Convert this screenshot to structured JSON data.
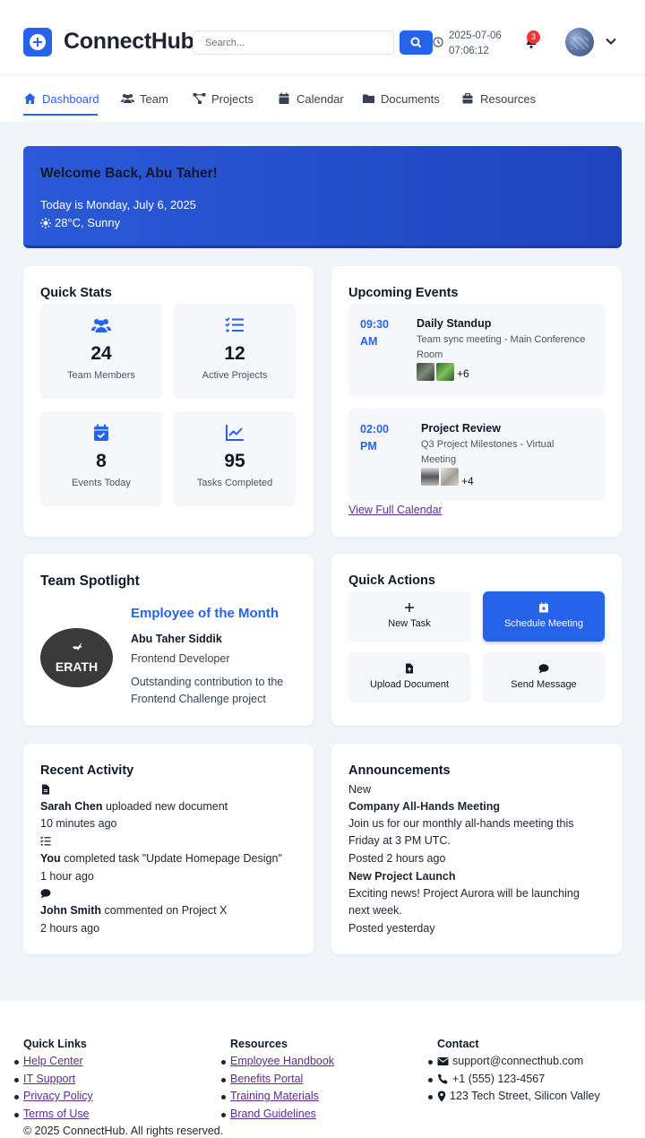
{
  "header": {
    "brand": "ConnectHub",
    "search_placeholder": "Search...",
    "date": "2025-07-06",
    "time": "07:06:12",
    "notification_count": "3"
  },
  "nav": {
    "items": [
      {
        "label": "Dashboard",
        "icon": "home-icon",
        "active": true
      },
      {
        "label": "Team",
        "icon": "users-icon"
      },
      {
        "label": "Projects",
        "icon": "project-diagram-icon"
      },
      {
        "label": "Calendar",
        "icon": "calendar-icon"
      },
      {
        "label": "Documents",
        "icon": "folder-icon"
      },
      {
        "label": "Resources",
        "icon": "toolbox-icon"
      }
    ]
  },
  "welcome": {
    "title": "Welcome Back, Abu Taher!",
    "date_line": "Today is Monday, July 6, 2025",
    "weather": "28°C, Sunny"
  },
  "quick_stats": {
    "title": "Quick Stats",
    "items": [
      {
        "value": "24",
        "label": "Team Members",
        "icon": "users-icon"
      },
      {
        "value": "12",
        "label": "Active Projects",
        "icon": "tasks-icon"
      },
      {
        "value": "8",
        "label": "Events Today",
        "icon": "calendar-check-icon"
      },
      {
        "value": "95",
        "label": "Tasks Completed",
        "icon": "chart-line-icon"
      }
    ]
  },
  "events": {
    "title": "Upcoming Events",
    "items": [
      {
        "time_1": "09:30",
        "time_2": "AM",
        "title": "Daily Standup",
        "desc_1": "Team sync meeting - Main Conference",
        "desc_2": "Room",
        "more": "+6"
      },
      {
        "time_1": "02:00",
        "time_2": "PM",
        "title": "Project Review",
        "desc_1": "Q3 Project Milestones - Virtual",
        "desc_2": "Meeting",
        "more": "+4"
      }
    ],
    "link": "View Full Calendar"
  },
  "spotlight": {
    "title": "Team Spotlight",
    "logo_text": "ERATH",
    "heading": "Employee of the Month",
    "name": "Abu Taher Siddik",
    "role": "Frontend Developer",
    "desc_1": "Outstanding contribution to the",
    "desc_2": "Frontend Challenge project"
  },
  "quick_actions": {
    "title": "Quick Actions",
    "items": [
      {
        "label": "New Task",
        "icon": "plus-icon"
      },
      {
        "label": "Schedule Meeting",
        "icon": "calendar-plus-icon"
      },
      {
        "label": "Upload Document",
        "icon": "file-upload-icon"
      },
      {
        "label": "Send Message",
        "icon": "comment-icon"
      }
    ]
  },
  "activity": {
    "title": "Recent Activity",
    "items": [
      {
        "user": "Sarah Chen",
        "action": " uploaded new document",
        "time": "10 minutes ago",
        "icon": "file-icon"
      },
      {
        "user": "You",
        "action": " completed task \"Update Homepage Design\"",
        "time": "1 hour ago",
        "icon": "tasks-icon"
      },
      {
        "user": "John Smith",
        "action": " commented on Project X",
        "time": "2 hours ago",
        "icon": "comment-icon"
      }
    ]
  },
  "announcements": {
    "title": "Announcements",
    "tag": "New",
    "items": [
      {
        "title": "Company All-Hands Meeting",
        "body_1": "Join us for our monthly all-hands meeting this",
        "body_2": "Friday at 3 PM UTC.",
        "posted": "Posted 2 hours ago"
      },
      {
        "title": "New Project Launch",
        "body_1": "Exciting news! Project Aurora will be launching",
        "body_2": "next week.",
        "posted": "Posted yesterday"
      }
    ]
  },
  "footer": {
    "quick_links": {
      "title": "Quick Links",
      "items": [
        "Help Center",
        "IT Support",
        "Privacy Policy",
        "Terms of Use"
      ]
    },
    "resources": {
      "title": "Resources",
      "items": [
        "Employee Handbook",
        "Benefits Portal",
        "Training Materials",
        "Brand Guidelines"
      ]
    },
    "contact": {
      "title": "Contact",
      "email": "support@connecthub.com",
      "phone": "+1 (555) 123-4567",
      "address": "123 Tech Street, Silicon Valley"
    },
    "copyright": "© 2025 ConnectHub. All rights reserved."
  },
  "colors": {
    "accent": "#2563eb",
    "badge": "#e53935",
    "link_visited": "#5b2d8e"
  }
}
